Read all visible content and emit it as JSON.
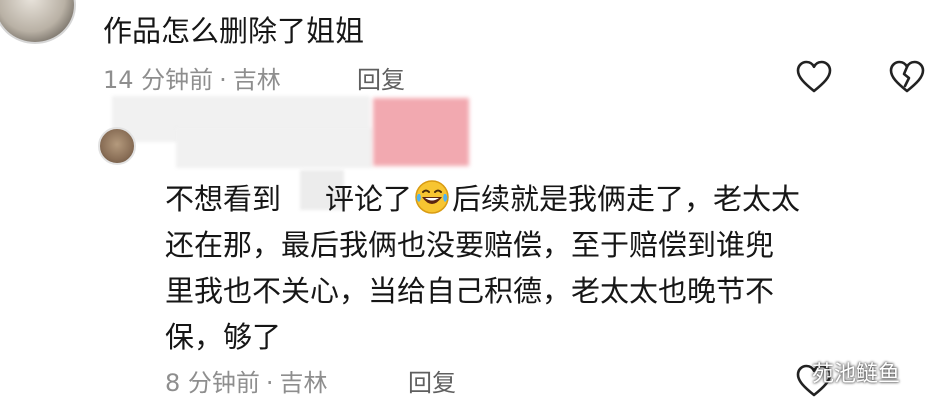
{
  "comments": [
    {
      "text": "作品怎么删除了姐姐",
      "time": "14 分钟前",
      "location": "吉林",
      "reply_label": "回复",
      "like_icon": "heart-outline-icon",
      "dislike_icon": "broken-heart-icon"
    },
    {
      "text_lines": [
        {
          "before": "不想看到",
          "after_gap": "评论了",
          "after_emoji": "后续就是我俩走了，老太太"
        },
        "还在那，最后我俩也没要赔偿，至于赔偿到谁兜",
        "里我也不关心，当给自己积德，老太太也晚节不",
        "保，够了"
      ],
      "emoji": "laughing-with-tears-emoji",
      "time": "8 分钟前",
      "location": "吉林",
      "reply_label": "回复",
      "like_icon": "heart-outline-icon"
    }
  ],
  "watermark": "苑池鲢鱼",
  "colors": {
    "text": "#161616",
    "meta": "#8e8e8e",
    "reply": "#5f5f5f",
    "icon": "#222222",
    "redaction_pink": "#f2a9b0"
  }
}
